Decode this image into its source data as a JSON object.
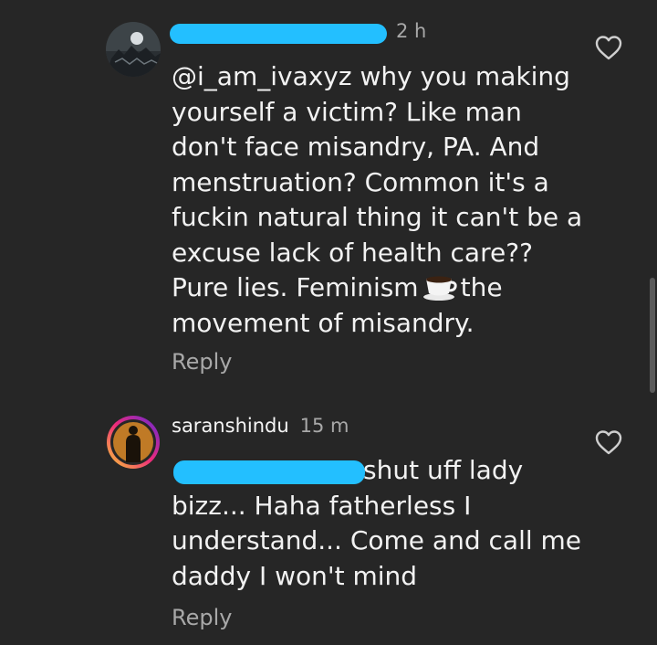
{
  "comment1": {
    "time": "2 h",
    "text_before_emoji": "@i_am_ivaxyz why you making yourself a victim? Like man don't face misandry, PA. And menstruation? Common it's a fuckin natural thing it can't be a excuse lack of health care?? Pure lies. Feminism",
    "emoji_name": "coffee-icon",
    "text_after_emoji": "the movement of misandry.",
    "reply_label": "Reply",
    "like_icon": "heart-outline-icon"
  },
  "comment2": {
    "username": "saranshindu",
    "time": "15 m",
    "text": "shut uff lady bizz... Haha fatherless I understand... Come and call me daddy I won't mind",
    "reply_label": "Reply",
    "like_icon": "heart-outline-icon"
  },
  "colors": {
    "background": "#262626",
    "redaction": "#23bfff",
    "secondary_text": "#a8a8a8"
  }
}
